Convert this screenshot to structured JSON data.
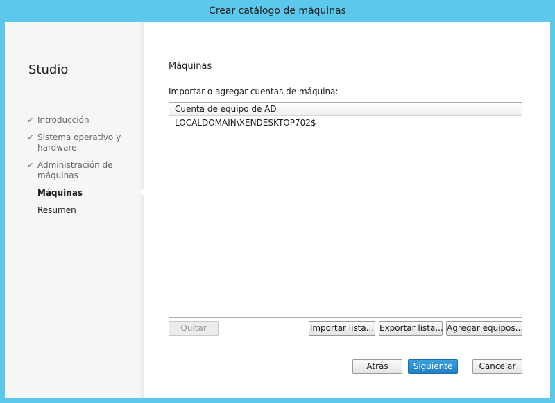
{
  "window": {
    "title": "Crear catálogo de máquinas"
  },
  "sidebar": {
    "brand": "Studio",
    "steps": [
      {
        "label": "Introducción",
        "state": "done"
      },
      {
        "label": "Sistema operativo y hardware",
        "state": "done"
      },
      {
        "label": "Administración de máquinas",
        "state": "done"
      },
      {
        "label": "Máquinas",
        "state": "current"
      },
      {
        "label": "Resumen",
        "state": "pending"
      }
    ],
    "check_icon": "✔"
  },
  "main": {
    "title": "Máquinas",
    "list_caption": "Importar o agregar cuentas de máquina:",
    "list": {
      "header": "Cuenta de equipo de AD",
      "rows": [
        "LOCALDOMAIN\\XENDESKTOP702$"
      ]
    },
    "buttons": {
      "remove": "Quitar",
      "import": "Importar lista...",
      "export": "Exportar lista...",
      "add": "Agregar equipos..."
    }
  },
  "footer": {
    "back": "Atrás",
    "next": "Siguiente",
    "cancel": "Cancelar"
  },
  "colors": {
    "frame": "#5bc8ec",
    "primary_button": "#1f7fc6"
  }
}
